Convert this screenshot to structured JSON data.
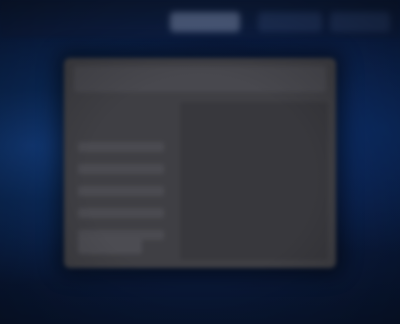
{
  "window": {
    "title": ""
  },
  "topbar": {
    "tabs": [
      {
        "label": "",
        "state": "active"
      },
      {
        "label": "",
        "state": "inactive"
      },
      {
        "label": "",
        "state": "inactive"
      }
    ]
  },
  "dialog": {
    "title": "",
    "sidebar_items": [
      "",
      "",
      "",
      "",
      ""
    ],
    "footer_button_label": ""
  },
  "colors": {
    "background": "#0b2150",
    "dialog": "#3f3f44",
    "accent_tab": "#5a6a8c"
  }
}
